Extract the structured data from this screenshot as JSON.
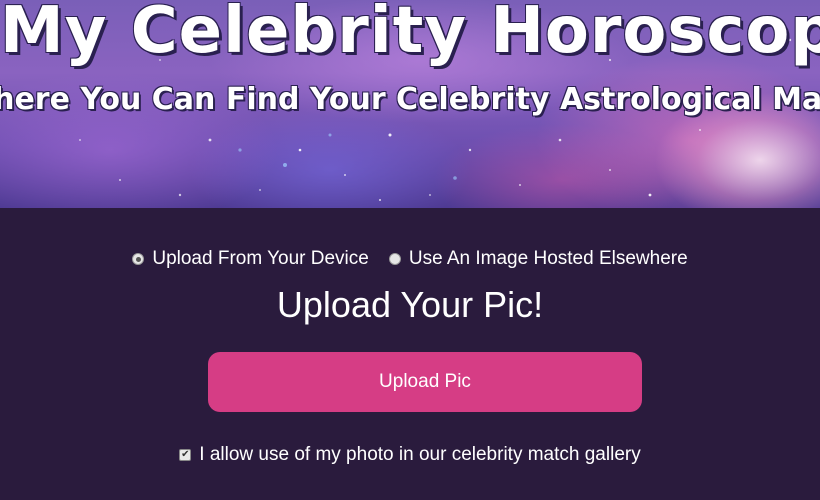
{
  "hero": {
    "title": "My Celebrity Horoscope!",
    "subtitle": "Where You Can Find Your Celebrity Astrological Match"
  },
  "upload_source": {
    "options": [
      {
        "label": "Upload From Your Device",
        "selected": true
      },
      {
        "label": "Use An Image Hosted Elsewhere",
        "selected": false
      }
    ]
  },
  "upload": {
    "heading": "Upload Your Pic!",
    "button_label": "Upload Pic"
  },
  "consent": {
    "label": "I allow use of my photo in our celebrity match gallery",
    "checked": true,
    "check_glyph": "✔"
  },
  "colors": {
    "background": "#2a1b3d",
    "button": "#d63d85",
    "text": "#ffffff"
  },
  "icons": {
    "hero_background": "galaxy-nebula-image",
    "radio_selected": "radio-checked-icon",
    "radio_unselected": "radio-unchecked-icon",
    "checkbox": "checkbox-checked-icon"
  }
}
